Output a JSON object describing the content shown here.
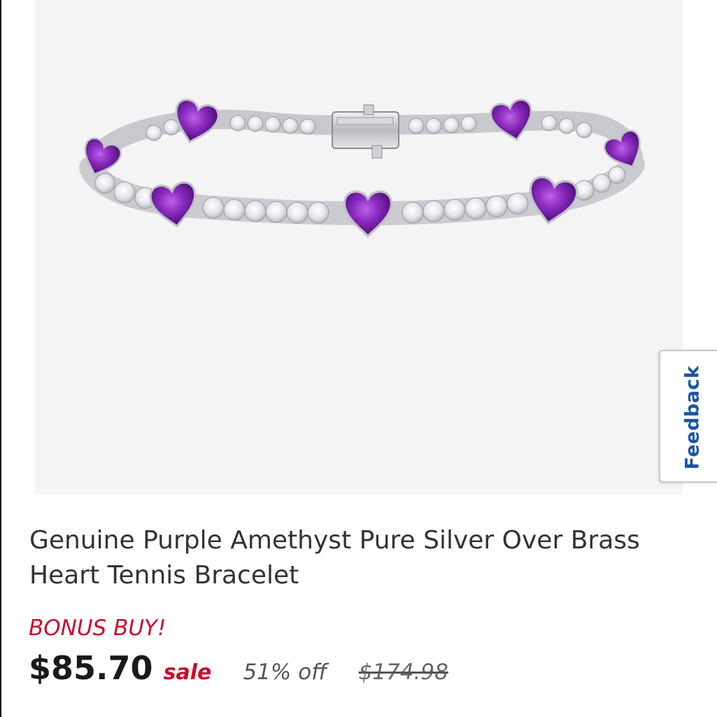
{
  "product": {
    "image_alt": "Genuine Purple Amethyst Pure Silver Over Brass Heart Tennis Bracelet",
    "title": "Genuine Purple Amethyst Pure Silver Over Brass Heart Tennis Bracelet",
    "promo_label": "BONUS BUY!",
    "price": "$85.70",
    "price_type": "sale",
    "discount": "51% off",
    "original_price": "$174.98"
  },
  "feedback": {
    "label": "Feedback"
  },
  "colors": {
    "accent_red": "#cc0a2c",
    "feedback_blue": "#1a55a4",
    "image_bg": "#f4f4f4",
    "amethyst": "#7a1fa8"
  }
}
